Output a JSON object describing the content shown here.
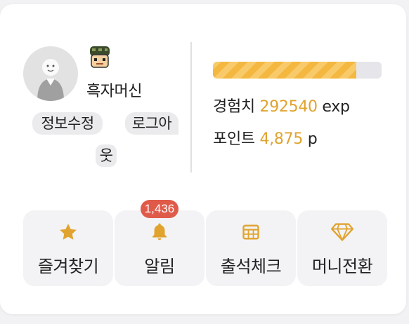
{
  "profile": {
    "nickname": "흑자머신",
    "edit_label": "정보수정",
    "logout_label_line1": "로그아",
    "logout_label_line2": "웃"
  },
  "stats": {
    "exp_label": "경험치",
    "exp_value": "292540",
    "exp_unit": "exp",
    "exp_progress_percent": 85,
    "point_label": "포인트",
    "point_value": "4,875",
    "point_unit": "p"
  },
  "menu": {
    "favorites": {
      "label": "즐겨찾기",
      "icon": "star-icon"
    },
    "alerts": {
      "label": "알림",
      "icon": "bell-icon",
      "badge": "1,436"
    },
    "attendance": {
      "label": "출석체크",
      "icon": "calendar-icon"
    },
    "money": {
      "label": "머니전환",
      "icon": "diamond-icon"
    }
  },
  "colors": {
    "accent": "#e0a32e",
    "badge": "#e05a4a",
    "exp_bar": "#f4b740"
  }
}
